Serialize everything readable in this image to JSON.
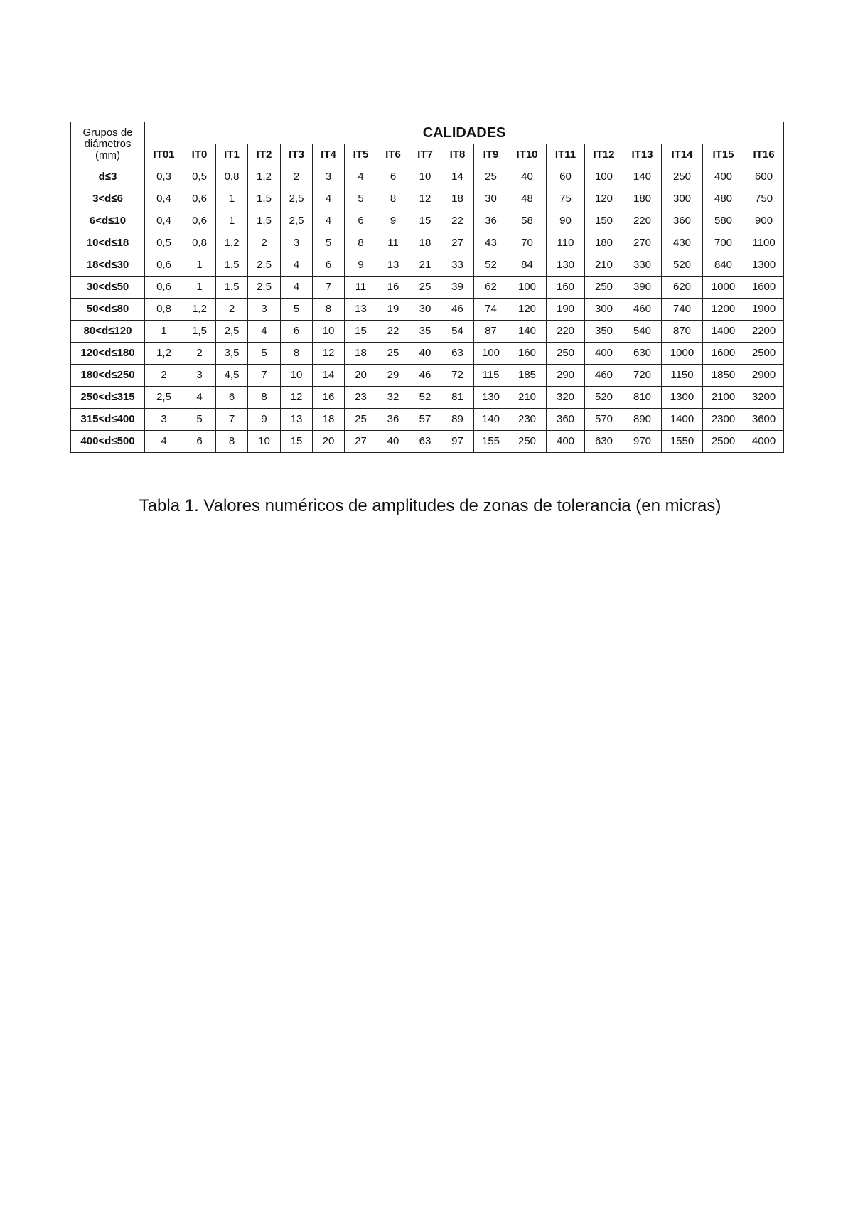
{
  "table": {
    "group_header": "Grupos de diámetros (mm)",
    "group_header_lines": [
      "Grupos de",
      "diámetros",
      "(mm)"
    ],
    "super_header": "CALIDADES",
    "columns": [
      "IT01",
      "IT0",
      "IT1",
      "IT2",
      "IT3",
      "IT4",
      "IT5",
      "IT6",
      "IT7",
      "IT8",
      "IT9",
      "IT10",
      "IT11",
      "IT12",
      "IT13",
      "IT14",
      "IT15",
      "IT16"
    ],
    "rows": [
      {
        "label": "d≤3",
        "values": [
          "0,3",
          "0,5",
          "0,8",
          "1,2",
          "2",
          "3",
          "4",
          "6",
          "10",
          "14",
          "25",
          "40",
          "60",
          "100",
          "140",
          "250",
          "400",
          "600"
        ]
      },
      {
        "label": "3<d≤6",
        "values": [
          "0,4",
          "0,6",
          "1",
          "1,5",
          "2,5",
          "4",
          "5",
          "8",
          "12",
          "18",
          "30",
          "48",
          "75",
          "120",
          "180",
          "300",
          "480",
          "750"
        ]
      },
      {
        "label": "6<d≤10",
        "values": [
          "0,4",
          "0,6",
          "1",
          "1,5",
          "2,5",
          "4",
          "6",
          "9",
          "15",
          "22",
          "36",
          "58",
          "90",
          "150",
          "220",
          "360",
          "580",
          "900"
        ]
      },
      {
        "label": "10<d≤18",
        "values": [
          "0,5",
          "0,8",
          "1,2",
          "2",
          "3",
          "5",
          "8",
          "11",
          "18",
          "27",
          "43",
          "70",
          "110",
          "180",
          "270",
          "430",
          "700",
          "1100"
        ]
      },
      {
        "label": "18<d≤30",
        "values": [
          "0,6",
          "1",
          "1,5",
          "2,5",
          "4",
          "6",
          "9",
          "13",
          "21",
          "33",
          "52",
          "84",
          "130",
          "210",
          "330",
          "520",
          "840",
          "1300"
        ]
      },
      {
        "label": "30<d≤50",
        "values": [
          "0,6",
          "1",
          "1,5",
          "2,5",
          "4",
          "7",
          "11",
          "16",
          "25",
          "39",
          "62",
          "100",
          "160",
          "250",
          "390",
          "620",
          "1000",
          "1600"
        ]
      },
      {
        "label": "50<d≤80",
        "values": [
          "0,8",
          "1,2",
          "2",
          "3",
          "5",
          "8",
          "13",
          "19",
          "30",
          "46",
          "74",
          "120",
          "190",
          "300",
          "460",
          "740",
          "1200",
          "1900"
        ]
      },
      {
        "label": "80<d≤120",
        "values": [
          "1",
          "1,5",
          "2,5",
          "4",
          "6",
          "10",
          "15",
          "22",
          "35",
          "54",
          "87",
          "140",
          "220",
          "350",
          "540",
          "870",
          "1400",
          "2200"
        ]
      },
      {
        "label": "120<d≤180",
        "values": [
          "1,2",
          "2",
          "3,5",
          "5",
          "8",
          "12",
          "18",
          "25",
          "40",
          "63",
          "100",
          "160",
          "250",
          "400",
          "630",
          "1000",
          "1600",
          "2500"
        ]
      },
      {
        "label": "180<d≤250",
        "values": [
          "2",
          "3",
          "4,5",
          "7",
          "10",
          "14",
          "20",
          "29",
          "46",
          "72",
          "115",
          "185",
          "290",
          "460",
          "720",
          "1150",
          "1850",
          "2900"
        ]
      },
      {
        "label": "250<d≤315",
        "values": [
          "2,5",
          "4",
          "6",
          "8",
          "12",
          "16",
          "23",
          "32",
          "52",
          "81",
          "130",
          "210",
          "320",
          "520",
          "810",
          "1300",
          "2100",
          "3200"
        ]
      },
      {
        "label": "315<d≤400",
        "values": [
          "3",
          "5",
          "7",
          "9",
          "13",
          "18",
          "25",
          "36",
          "57",
          "89",
          "140",
          "230",
          "360",
          "570",
          "890",
          "1400",
          "2300",
          "3600"
        ]
      },
      {
        "label": "400<d≤500",
        "values": [
          "4",
          "6",
          "8",
          "10",
          "15",
          "20",
          "27",
          "40",
          "63",
          "97",
          "155",
          "250",
          "400",
          "630",
          "970",
          "1550",
          "2500",
          "4000"
        ]
      }
    ]
  },
  "caption": "Tabla 1. Valores numéricos de amplitudes de zonas de tolerancia (en micras)"
}
